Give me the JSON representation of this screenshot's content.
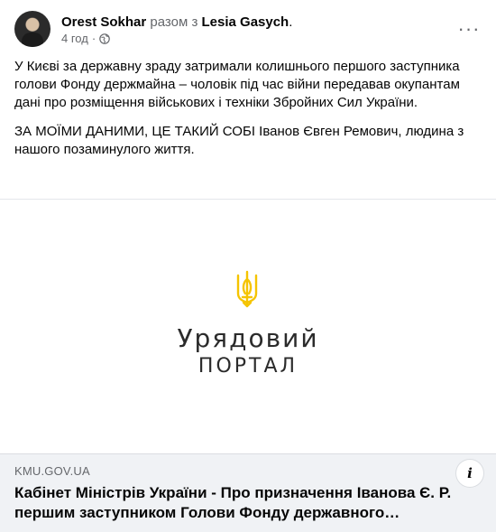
{
  "post": {
    "author": "Orest Sokhar",
    "with_text": "разом з",
    "tagged": "Lesia Gasych",
    "tagged_suffix": ".",
    "time": "4 год",
    "separator": "·",
    "more_glyph": "···",
    "paragraph1": "У Києві за державну зраду затримали колишнього першого заступника голови Фонду держмайна – чоловік під час війни передавав окупантам дані про розміщення військових і техніки Збройних Сил України.",
    "paragraph2": "ЗА МОЇМИ ДАНИМИ, ЦЕ ТАКИЙ СОБІ Іванов Євген Ремович, людина з нашого позаминулого життя."
  },
  "image": {
    "line1": "Урядовий",
    "line2": "ПОРТАЛ",
    "trident_color": "#f5c400"
  },
  "link": {
    "domain": "KMU.GOV.UA",
    "title": "Кабінет Міністрів України - Про призначення Іванова Є. Р. першим заступником Голови Фонду державного…",
    "info_glyph": "i"
  },
  "icons": {
    "audience": "globe-icon",
    "more": "more-options-icon",
    "info": "info-icon"
  }
}
